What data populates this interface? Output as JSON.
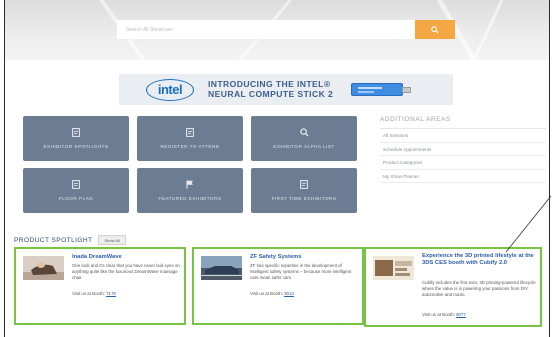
{
  "search": {
    "placeholder": "Search All Showcase"
  },
  "banner": {
    "logo_text": "intel",
    "line1": "INTRODUCING THE INTEL®",
    "line2": "NEURAL COMPUTE STICK 2"
  },
  "tiles": [
    {
      "label": "EXHIBITOR SPOTLIGHTS",
      "icon": "document-icon"
    },
    {
      "label": "REGISTER TO ATTEND",
      "icon": "document-icon"
    },
    {
      "label": "EXHIBITOR ALPHA LIST",
      "icon": "search-icon"
    },
    {
      "label": "FLOOR PLAN",
      "icon": "document-icon"
    },
    {
      "label": "FEATURED EXHIBITORS",
      "icon": "flag-icon"
    },
    {
      "label": "FIRST TIME EXHIBITORS",
      "icon": "document-icon"
    }
  ],
  "additional_areas": {
    "title": "ADDITIONAL AREAS",
    "items": [
      "All Sessions",
      "Schedule Appointments",
      "Product Categories",
      "My Show Planner"
    ]
  },
  "spotlight": {
    "title": "PRODUCT SPOTLIGHT",
    "show_all": "Show All",
    "cards": [
      {
        "title": "Inada DreamWave",
        "desc": "One look and it's clear that you have never laid eyes on anything quite like the luxurious DreamWave massage chair.",
        "booth_prefix": "Visit us at Booth:",
        "booth": "7178"
      },
      {
        "title": "ZF Safety Systems",
        "desc": "ZF has specific expertise in the development of intelligent safety systems – because more intelligent cars mean safer cars.",
        "booth_prefix": "Visit us at Booth:",
        "booth": "3013"
      },
      {
        "title": "Experience the 3D printed lifestyle at the 3DS CES booth with Cubify 2.0",
        "desc": "Cubify includes the first ever, 3D printing-powered lifecycle where the value is in powering your passions from DIY, automotive and music.",
        "booth_prefix": "Visit us at Booth:",
        "booth": "8077"
      }
    ]
  },
  "colors": {
    "accent_orange": "#f4a742",
    "tile_bg": "#6c7d93",
    "highlight_green": "#77c442",
    "link_blue": "#2d5da8"
  }
}
